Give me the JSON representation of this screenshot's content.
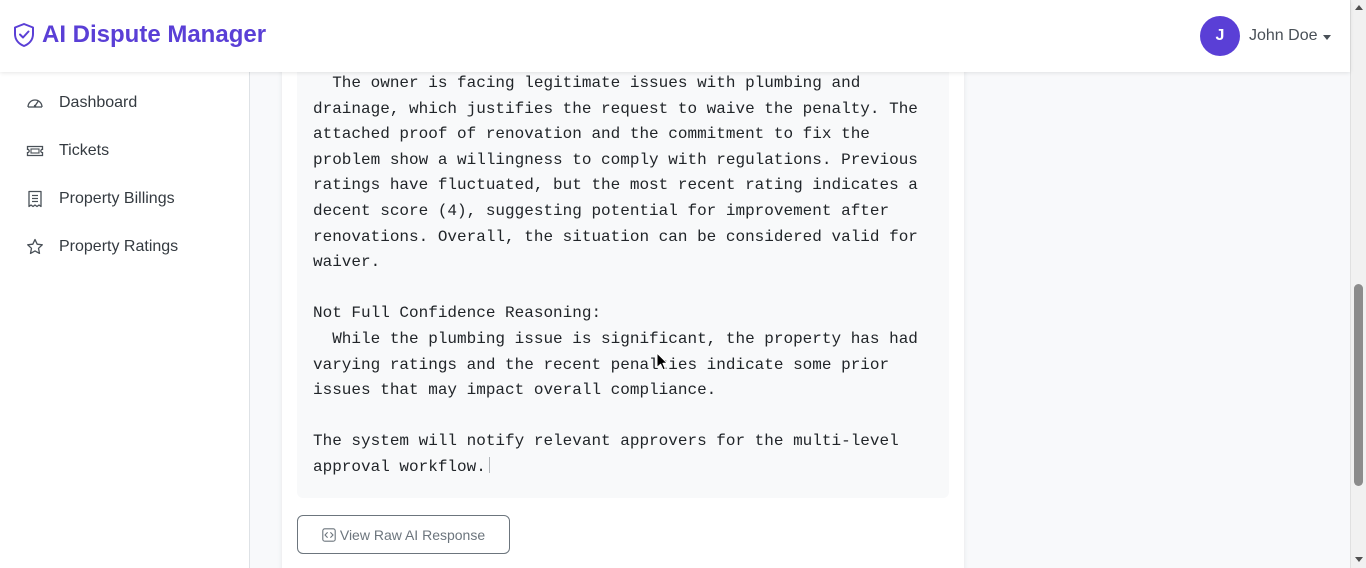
{
  "app": {
    "title": "AI Dispute Manager",
    "brand_icon": "shield-check-icon",
    "accent_color": "#5a3fd6"
  },
  "user": {
    "initial": "J",
    "name": "John Doe"
  },
  "sidebar": {
    "items": [
      {
        "label": "Dashboard",
        "icon": "speedometer-icon"
      },
      {
        "label": "Tickets",
        "icon": "ticket-icon"
      },
      {
        "label": "Property Billings",
        "icon": "receipt-icon"
      },
      {
        "label": "Property Ratings",
        "icon": "star-icon"
      }
    ]
  },
  "ai_response": {
    "text": "  The owner is facing legitimate issues with plumbing and\ndrainage, which justifies the request to waive the penalty. The\nattached proof of renovation and the commitment to fix the\nproblem show a willingness to comply with regulations. Previous\nratings have fluctuated, but the most recent rating indicates a\ndecent score (4), suggesting potential for improvement after\nrenovations. Overall, the situation can be considered valid for\nwaiver.\n\nNot Full Confidence Reasoning:\n  While the plumbing issue is significant, the property has had\nvarying ratings and the recent penalties indicate some prior\nissues that may impact overall compliance.\n\nThe system will notify relevant approvers for the multi-level\napproval workflow."
  },
  "buttons": {
    "view_raw_label": "View Raw AI Response",
    "view_raw_icon": "code-square-icon"
  },
  "scrollbar": {
    "position_fraction": 0.8
  }
}
